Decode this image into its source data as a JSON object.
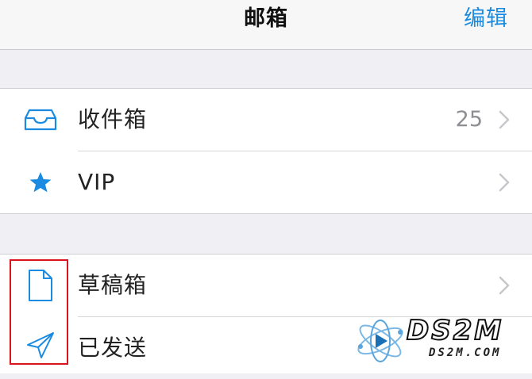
{
  "navbar": {
    "title": "邮箱",
    "edit_label": "编辑"
  },
  "mailboxes": {
    "group1": [
      {
        "label": "收件箱",
        "count": "25",
        "icon": "inbox-tray-icon"
      },
      {
        "label": "VIP",
        "count": "",
        "icon": "star-icon"
      }
    ],
    "group2": [
      {
        "label": "草稿箱",
        "icon": "document-icon"
      },
      {
        "label": "已发送",
        "icon": "paper-plane-icon"
      }
    ]
  },
  "watermark": {
    "brand": "DS2M",
    "domain": "DS2M.COM"
  },
  "colors": {
    "accent": "#1a8be0",
    "background": "#efeff4",
    "highlight": "#d9141c"
  }
}
